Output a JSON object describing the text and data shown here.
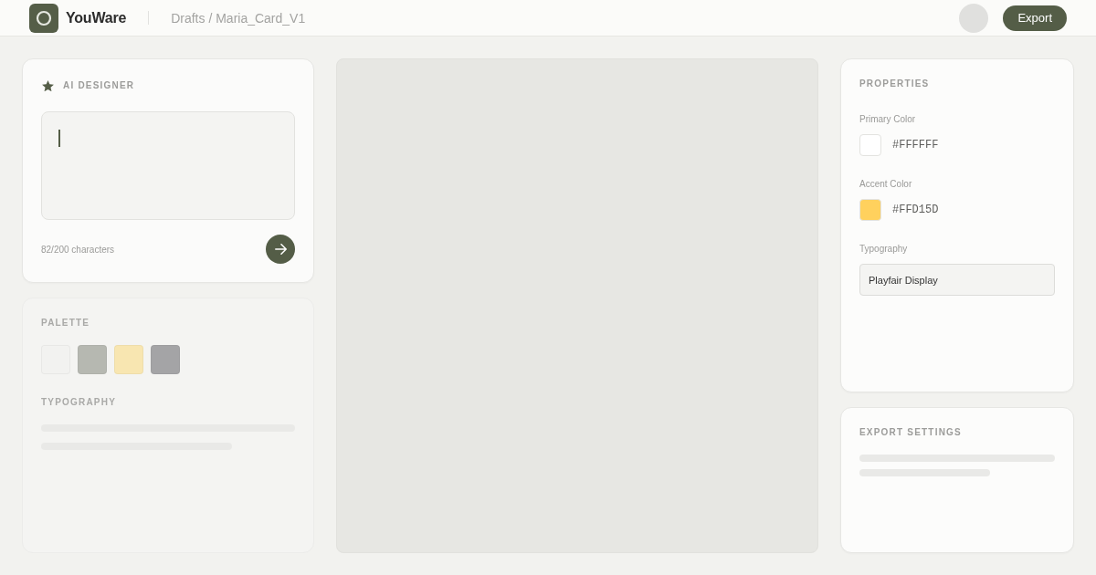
{
  "header": {
    "brand": "YouWare",
    "breadcrumb": "Drafts / Maria_Card_V1",
    "export_button": "Export"
  },
  "ai_designer": {
    "title": "AI DESIGNER",
    "prompt": {
      "focused": true
    },
    "char_count": "82/200 characters"
  },
  "palette_panel": {
    "dimmed": true,
    "title": "PALETTE",
    "swatches": [
      {
        "color": "#f2f2f0"
      },
      {
        "color": "#b6b8b1"
      },
      {
        "color": "#f8e6b1"
      },
      {
        "color": "#a4a4a6"
      }
    ],
    "typography": {
      "title": "TYPOGRAPHY",
      "loading": true
    }
  },
  "properties": {
    "title": "PROPERTIES",
    "fields": [
      {
        "kind": "color",
        "label": "Primary Color",
        "color": "#ffffff",
        "value": "#FFFFFF"
      },
      {
        "kind": "color",
        "label": "Accent Color",
        "color": "#ffd15d",
        "value": "#FFD15D"
      },
      {
        "kind": "font",
        "label": "Typography",
        "value": "Playfair Display"
      }
    ]
  },
  "export_settings": {
    "title": "EXPORT SETTINGS",
    "loading": true
  }
}
